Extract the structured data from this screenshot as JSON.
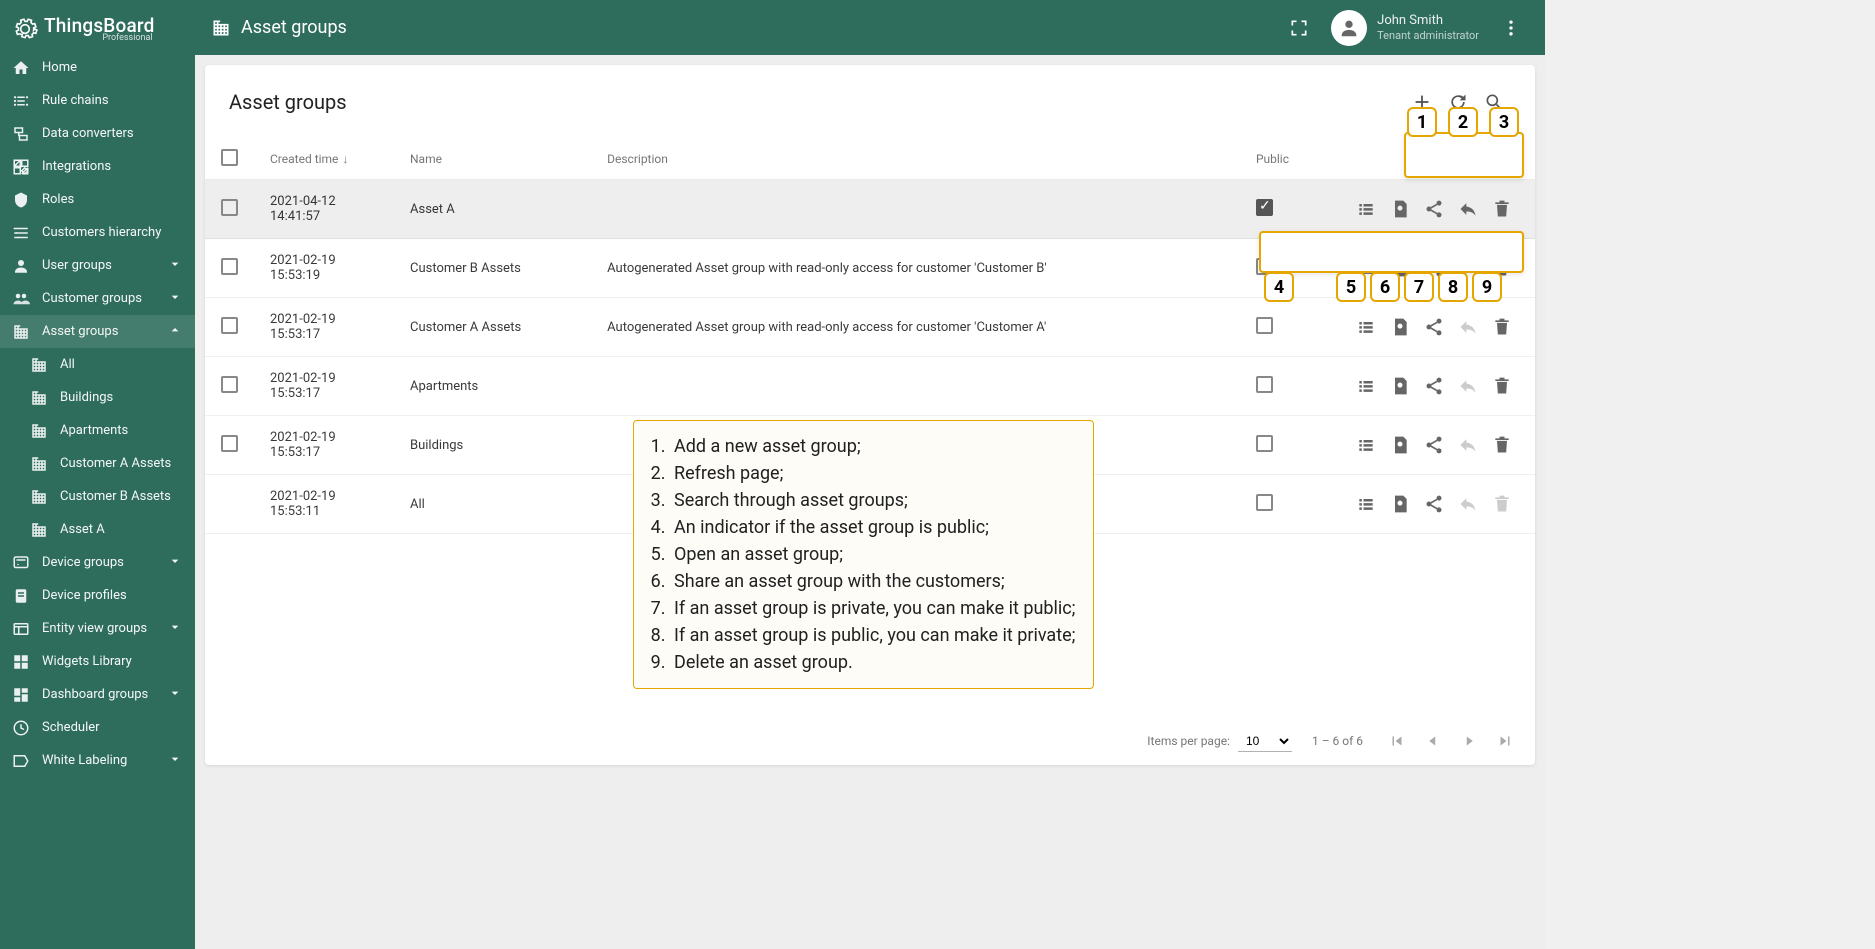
{
  "brand": {
    "name": "ThingsBoard",
    "edition": "Professional"
  },
  "user": {
    "name": "John Smith",
    "role": "Tenant administrator"
  },
  "topbar": {
    "title": "Asset groups"
  },
  "sidebar": {
    "items": [
      {
        "label": "Home",
        "icon": "home",
        "chev": "",
        "sub": false,
        "active": false
      },
      {
        "label": "Rule chains",
        "icon": "rule",
        "chev": "",
        "sub": false,
        "active": false
      },
      {
        "label": "Data converters",
        "icon": "converter",
        "chev": "",
        "sub": false,
        "active": false
      },
      {
        "label": "Integrations",
        "icon": "integration",
        "chev": "",
        "sub": false,
        "active": false
      },
      {
        "label": "Roles",
        "icon": "shield",
        "chev": "",
        "sub": false,
        "active": false
      },
      {
        "label": "Customers hierarchy",
        "icon": "hierarchy",
        "chev": "",
        "sub": false,
        "active": false
      },
      {
        "label": "User groups",
        "icon": "user",
        "chev": "down",
        "sub": false,
        "active": false
      },
      {
        "label": "Customer groups",
        "icon": "customers",
        "chev": "down",
        "sub": false,
        "active": false
      },
      {
        "label": "Asset groups",
        "icon": "domain",
        "chev": "up",
        "sub": false,
        "active": true
      },
      {
        "label": "All",
        "icon": "domain",
        "chev": "",
        "sub": true,
        "active": false
      },
      {
        "label": "Buildings",
        "icon": "domain",
        "chev": "",
        "sub": true,
        "active": false
      },
      {
        "label": "Apartments",
        "icon": "domain",
        "chev": "",
        "sub": true,
        "active": false
      },
      {
        "label": "Customer A Assets",
        "icon": "domain",
        "chev": "",
        "sub": true,
        "active": false
      },
      {
        "label": "Customer B Assets",
        "icon": "domain",
        "chev": "",
        "sub": true,
        "active": false
      },
      {
        "label": "Asset A",
        "icon": "domain",
        "chev": "",
        "sub": true,
        "active": false
      },
      {
        "label": "Device groups",
        "icon": "device",
        "chev": "down",
        "sub": false,
        "active": false
      },
      {
        "label": "Device profiles",
        "icon": "profile",
        "chev": "",
        "sub": false,
        "active": false
      },
      {
        "label": "Entity view groups",
        "icon": "entity",
        "chev": "down",
        "sub": false,
        "active": false
      },
      {
        "label": "Widgets Library",
        "icon": "widgets",
        "chev": "",
        "sub": false,
        "active": false
      },
      {
        "label": "Dashboard groups",
        "icon": "dashboard",
        "chev": "down",
        "sub": false,
        "active": false
      },
      {
        "label": "Scheduler",
        "icon": "schedule",
        "chev": "",
        "sub": false,
        "active": false
      },
      {
        "label": "White Labeling",
        "icon": "label",
        "chev": "down",
        "sub": false,
        "active": false
      }
    ]
  },
  "card": {
    "title": "Asset groups",
    "columns": {
      "created": "Created time",
      "name": "Name",
      "description": "Description",
      "public": "Public"
    }
  },
  "rows": [
    {
      "created": "2021-04-12 14:41:57",
      "name": "Asset A",
      "description": "",
      "public": true,
      "highlight": true,
      "no_check": false,
      "reply_disabled": false,
      "del_disabled": false
    },
    {
      "created": "2021-02-19 15:53:19",
      "name": "Customer B Assets",
      "description": "Autogenerated Asset group with read-only access for customer 'Customer B'",
      "public": false,
      "highlight": false,
      "no_check": false,
      "reply_disabled": false,
      "del_disabled": false
    },
    {
      "created": "2021-02-19 15:53:17",
      "name": "Customer A Assets",
      "description": "Autogenerated Asset group with read-only access for customer 'Customer A'",
      "public": false,
      "highlight": false,
      "no_check": false,
      "reply_disabled": true,
      "del_disabled": false
    },
    {
      "created": "2021-02-19 15:53:17",
      "name": "Apartments",
      "description": "",
      "public": false,
      "highlight": false,
      "no_check": false,
      "reply_disabled": true,
      "del_disabled": false
    },
    {
      "created": "2021-02-19 15:53:17",
      "name": "Buildings",
      "description": "",
      "public": false,
      "highlight": false,
      "no_check": false,
      "reply_disabled": true,
      "del_disabled": false
    },
    {
      "created": "2021-02-19 15:53:11",
      "name": "All",
      "description": "",
      "public": false,
      "highlight": false,
      "no_check": true,
      "reply_disabled": true,
      "del_disabled": true
    }
  ],
  "paginator": {
    "label": "Items per page:",
    "size": "10",
    "range": "1 – 6 of 6"
  },
  "legend": [
    "Add a new asset group;",
    "Refresh page;",
    "Search through asset groups;",
    "An indicator if the asset group is public;",
    "Open an asset group;",
    "Share an asset group with the customers;",
    "If an asset group is private, you can make it public;",
    "If an asset group is public, you can make it private;",
    "Delete an asset group."
  ]
}
